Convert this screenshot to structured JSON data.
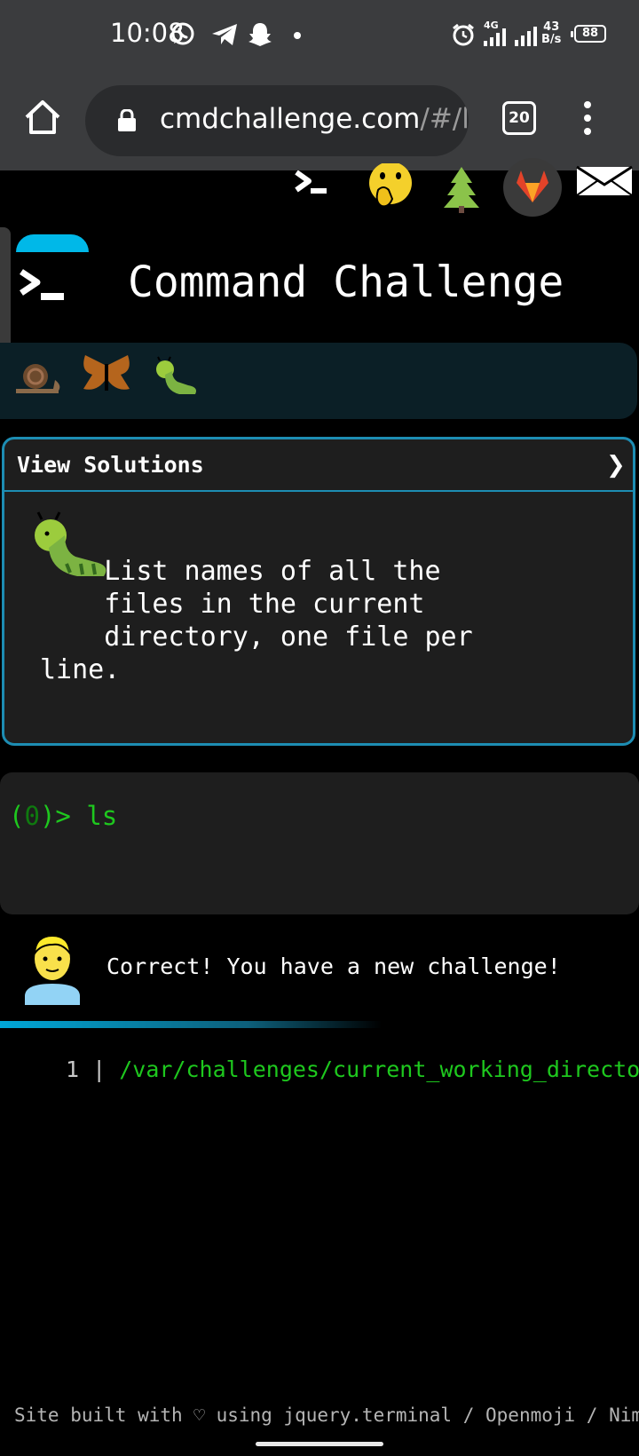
{
  "status_bar": {
    "time": "10:08",
    "network": "4G",
    "speed_value": "43",
    "speed_unit": "B/s",
    "battery": "88"
  },
  "browser": {
    "url_main": "cmdchallenge.com",
    "url_tail": "/#/l",
    "tab_count": "20"
  },
  "header": {
    "title": "Command Challenge"
  },
  "card": {
    "header_label": "View Solutions",
    "chevron": "❯",
    "description_lines": [
      "    List names of all the",
      "    files in the current",
      "    directory, one file per",
      "line."
    ]
  },
  "terminal": {
    "prompt_open": "(",
    "prompt_num": "0",
    "prompt_close": ")> ",
    "command": "ls"
  },
  "result": {
    "message": "Correct! You have a new challenge!"
  },
  "output": {
    "line_number": "1",
    "separator": " | ",
    "path": "/var/challenges/current_working_directory"
  },
  "footer": {
    "text": "Site built with ♡ using jquery.terminal / Openmoji / Nim"
  },
  "icons": {
    "top_row": [
      "terminal-icon",
      "face-with-hand-over-mouth-icon",
      "tree-icon",
      "gitlab-icon",
      "envelope-icon"
    ],
    "progress": [
      "snail-icon",
      "moth-icon",
      "caterpillar-icon"
    ]
  },
  "colors": {
    "accent": "#1d8db3",
    "prompt_green": "#1ec81e",
    "umbrella": "#00b8e8"
  }
}
